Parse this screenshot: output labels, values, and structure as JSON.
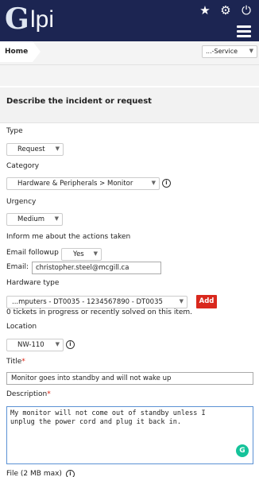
{
  "header": {
    "brand": "lpi",
    "brand_initial": "G",
    "icons": [
      "star-icon",
      "gear-icon",
      "logout-icon",
      "menu-icon"
    ]
  },
  "breadcrumb": {
    "home": "Home"
  },
  "service_select": {
    "value": "...-Service"
  },
  "form": {
    "title": "Describe the incident or request",
    "type_label": "Type",
    "type_value": "Request",
    "category_label": "Category",
    "category_value": "Hardware & Peripherals > Monitor",
    "urgency_label": "Urgency",
    "urgency_value": "Medium",
    "inform_label": "Inform me about the actions taken",
    "email_followup_label": "Email followup",
    "email_followup_value": "Yes",
    "email_label": "Email:",
    "email_value": "christopher.steel@mcgill.ca",
    "hardware_label": "Hardware type",
    "hardware_value": "...mputers - DT0035 - 1234567890 - DT0035",
    "add_label": "Add",
    "tickets_note": "0 tickets in progress or recently solved on this item.",
    "location_label": "Location",
    "location_value": "NW-110",
    "title_label": "Title",
    "title_value": "Monitor goes into standby and will not wake up",
    "description_label": "Description",
    "description_value": "My monitor will not come out of standby unless I\nunplug the power cord and plug it back in.",
    "file_label": "File (2 MB max)",
    "required_mark": "*"
  },
  "colors": {
    "topbar": "#1c2552",
    "add_button": "#d9281d",
    "focus_border": "#5b91d4",
    "grammarly": "#15c39a"
  }
}
